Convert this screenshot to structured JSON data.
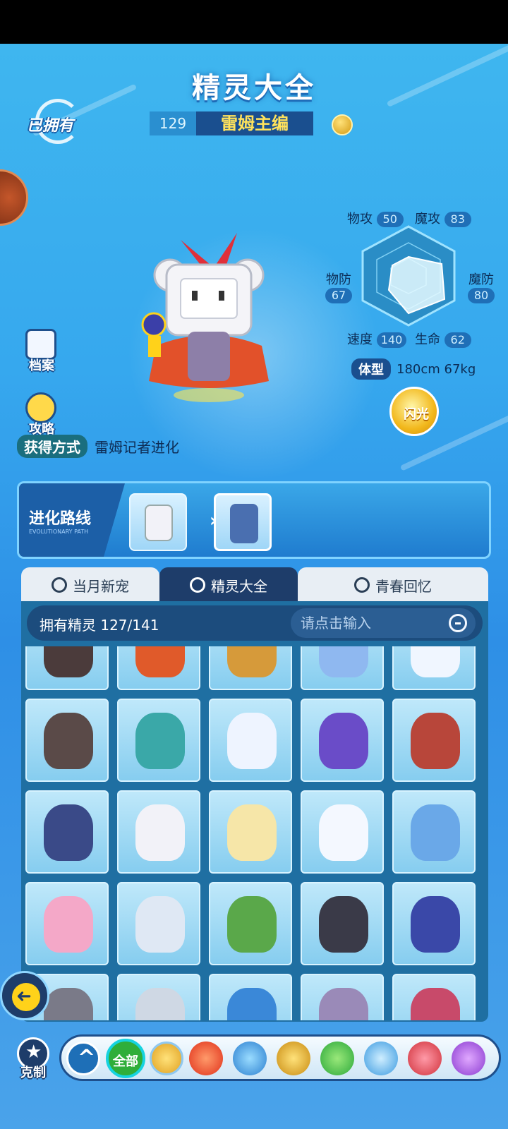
{
  "header": {
    "title": "精灵大全",
    "owned_badge": "已拥有"
  },
  "pet": {
    "number": "129",
    "name": "雷姆主编",
    "element_icon": "electric-type-icon",
    "stats": {
      "atk_label": "物攻",
      "atk": "50",
      "matk_label": "魔攻",
      "matk": "83",
      "def_label": "物防",
      "def": "67",
      "mdef_label": "魔防",
      "mdef": "80",
      "spd_label": "速度",
      "spd": "140",
      "hp_label": "生命",
      "hp": "62"
    },
    "body_label": "体型",
    "body_value": "180cm 67kg",
    "shiny_label": "闪光",
    "obtain_label": "获得方式",
    "obtain_value": "雷姆记者进化"
  },
  "side_buttons": {
    "archive": "档案",
    "guide": "攻略"
  },
  "evolution": {
    "label": "进化路线",
    "subtitle": "EVOLUTIONARY PATH"
  },
  "tabs": [
    {
      "label": "当月新宠"
    },
    {
      "label": "精灵大全"
    },
    {
      "label": "青春回忆"
    }
  ],
  "list": {
    "owned_count": "拥有精灵 127/141",
    "search_placeholder": "请点击输入"
  },
  "bottom_bar": {
    "counter_label": "克制",
    "all_label": "全部",
    "filters": [
      "light-icon",
      "fire-icon",
      "wind-icon",
      "electric-icon",
      "grass-icon",
      "ice-icon",
      "fighting-icon",
      "poison-icon"
    ]
  },
  "colors": {
    "accent": "#1e3d6a",
    "name_text": "#ffe25c",
    "background": "#36a8ee"
  }
}
